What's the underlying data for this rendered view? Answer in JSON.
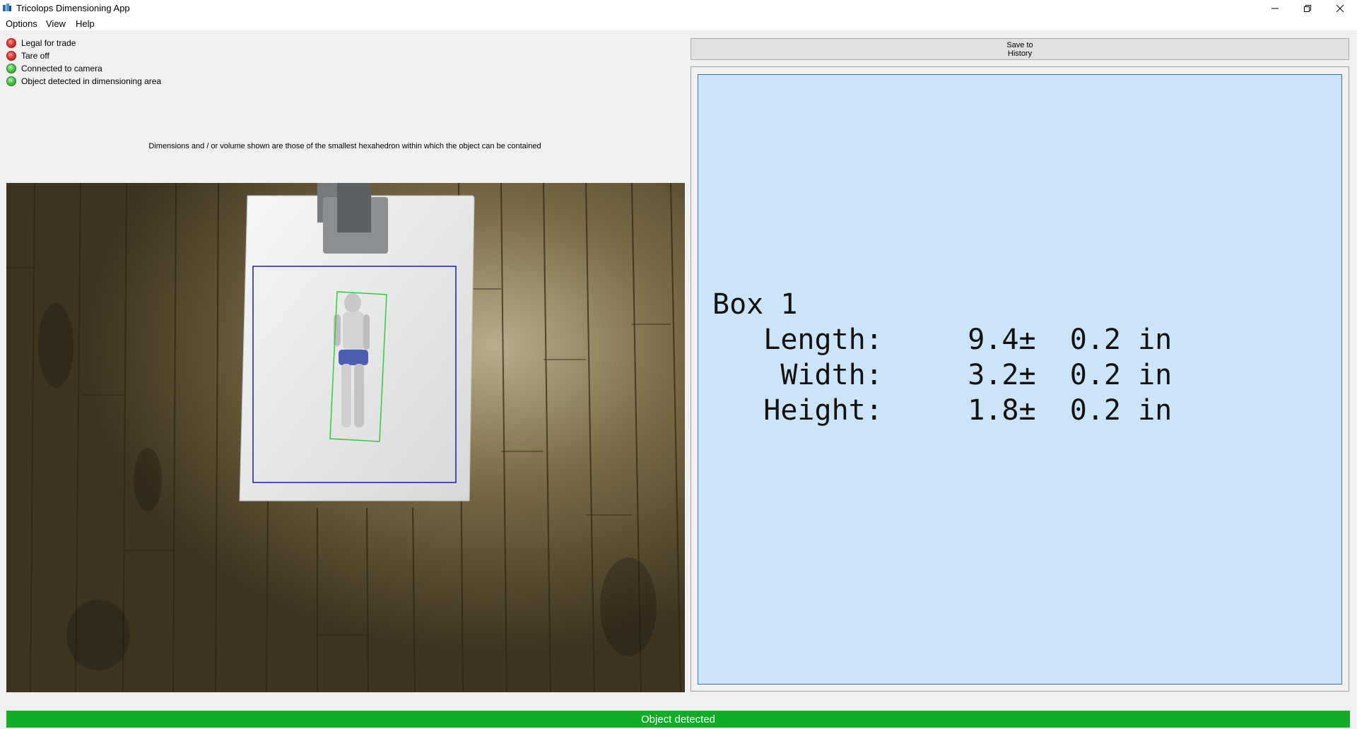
{
  "window": {
    "title": "Tricolops Dimensioning App",
    "icons": [
      "app-icon",
      "minimize-icon",
      "restore-icon",
      "close-icon"
    ]
  },
  "menu": [
    "Options",
    "View",
    "Help"
  ],
  "status_indicators": [
    {
      "label": "Legal for trade",
      "state": "red"
    },
    {
      "label": "Tare off",
      "state": "red"
    },
    {
      "label": "Connected to camera",
      "state": "green"
    },
    {
      "label": "Object detected in dimensioning area",
      "state": "green"
    }
  ],
  "note": "Dimensions and / or volume shown are those of the smallest hexahedron within which the object can be contained",
  "save_button": {
    "line1": "Save to",
    "line2": "History"
  },
  "result": {
    "box_title": "Box 1",
    "rows": [
      {
        "label": "Length:",
        "value": "9.4",
        "tolerance": "0.2",
        "unit": "in"
      },
      {
        "label": "Width:",
        "value": "3.2",
        "tolerance": "0.2",
        "unit": "in"
      },
      {
        "label": "Height:",
        "value": "1.8",
        "tolerance": "0.2",
        "unit": "in"
      }
    ]
  },
  "status_bar": "Object detected",
  "colors": {
    "status_green": "#10ae26",
    "result_panel_bg": "#cce4f7",
    "led_red": "#e23a3a",
    "led_green": "#4cc74a",
    "bbox_green": "#2ecc40",
    "dimension_area_blue": "#1a1aa8"
  }
}
